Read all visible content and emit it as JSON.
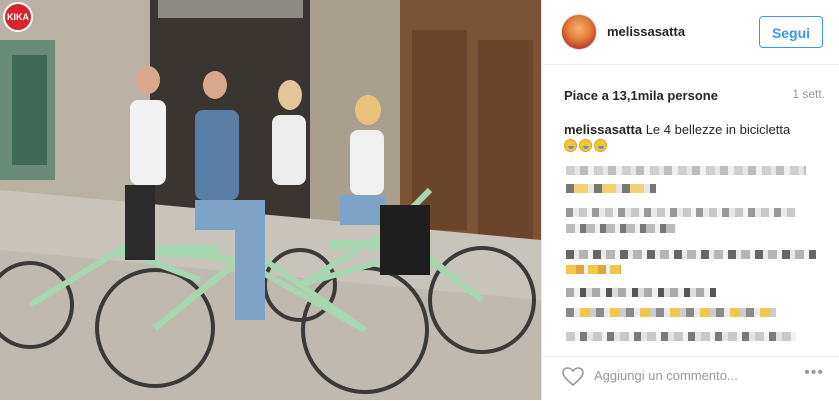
{
  "post": {
    "username": "melissasatta",
    "follow_label": "Segui",
    "likes": "Piace a 13,1mila persone",
    "time": "1 sett.",
    "caption_user": "melissasatta",
    "caption_text": "Le 4 bellezze in bicicletta",
    "emoji_icons": [
      "crying-laughing-emoji",
      "crying-laughing-emoji",
      "crying-laughing-emoji"
    ],
    "comment_placeholder": "Aggiungi un commento...",
    "more_label": "•••"
  },
  "watermark": {
    "logo_text": "KIKA"
  },
  "colors": {
    "accent": "#3897f0",
    "bike": "#a7d6b0",
    "logo": "#d6262c"
  }
}
